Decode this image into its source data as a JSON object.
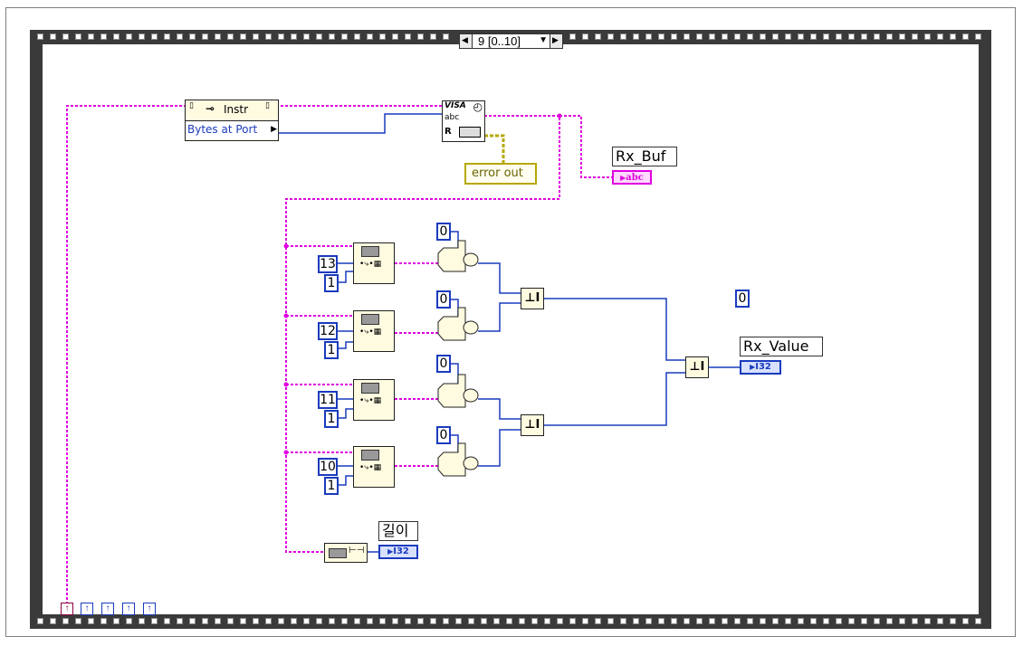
{
  "sequence": {
    "frame_label": "9 [0..10]"
  },
  "visa": {
    "property_node_label": "Instr",
    "property_label": "Bytes at Port",
    "read_icon_top": "VISA",
    "read_icon_mid": "abc",
    "read_icon_r": "R"
  },
  "indicators": {
    "error_out": "error out",
    "rx_buf": "Rx_Buf",
    "rx_value": "Rx_Value",
    "length_label": "길이"
  },
  "terminals": {
    "abc": "abc",
    "i32_a": "I32",
    "i32_b": "I32"
  },
  "constants": {
    "offsets": [
      "13",
      "12",
      "11",
      "10"
    ],
    "lengths": [
      "1",
      "1",
      "1",
      "1"
    ],
    "selects": [
      "0",
      "0",
      "0",
      "0"
    ],
    "free_zero": "0"
  },
  "colors": {
    "string_wire": "#e000e0",
    "numeric_wire": "#1a3bbd",
    "error_wire": "#b5a800",
    "frame": "#3a3a3a"
  },
  "icons": {
    "shift_register_arrow": "↑",
    "selector_prev": "◀",
    "selector_next": "▶",
    "selector_dropdown": "▼"
  }
}
